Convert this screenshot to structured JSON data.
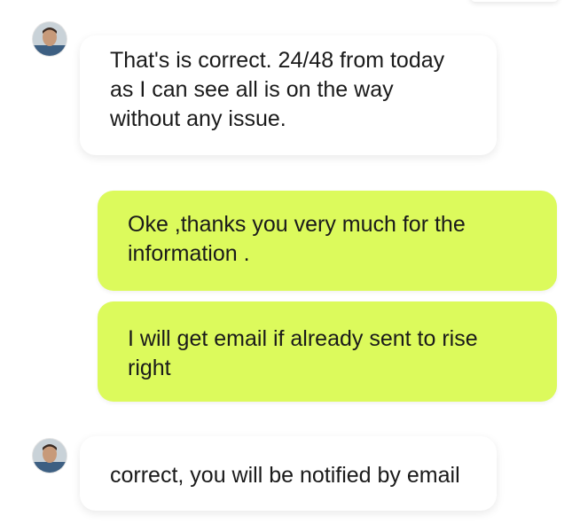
{
  "messages": [
    {
      "sender": "agent",
      "lines": [
        "That's is correct. 24/48 from today",
        "as I can see all is on the way",
        "without any issue."
      ]
    },
    {
      "sender": "user",
      "lines": [
        "Oke ,thanks you very much for the",
        "information ."
      ]
    },
    {
      "sender": "user",
      "lines": [
        "I will get email if already sent to rise",
        "right"
      ]
    },
    {
      "sender": "agent",
      "lines": [
        "correct, you will be notified by email"
      ]
    }
  ],
  "colors": {
    "user_bubble": "#dcfa5c",
    "agent_bubble": "#ffffff",
    "text": "#1a1a1a"
  },
  "icons": {
    "agent_avatar": "agent-avatar-icon"
  }
}
